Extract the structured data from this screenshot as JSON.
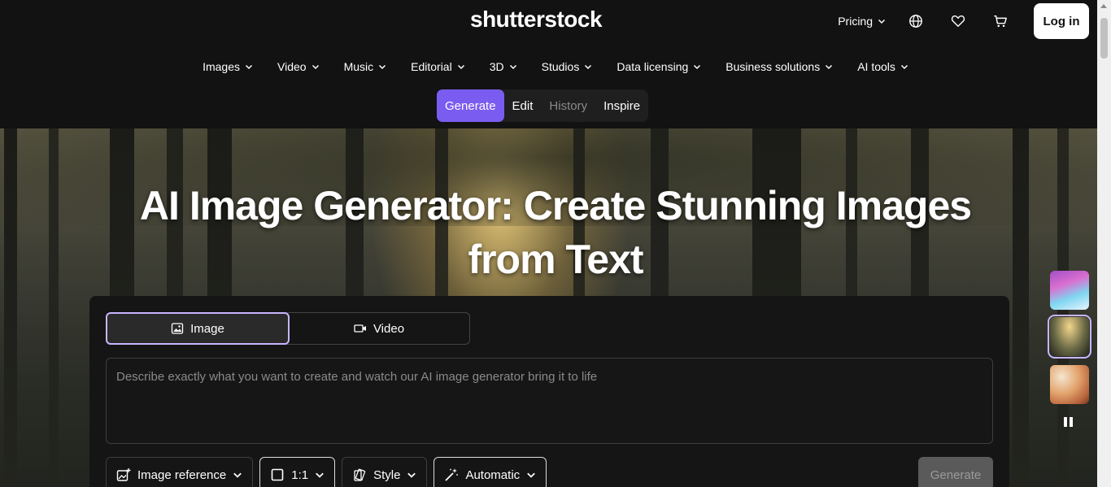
{
  "header": {
    "logo": "shutterstock",
    "pricing_label": "Pricing",
    "login_label": "Log in",
    "icons": [
      "globe-icon",
      "heart-icon",
      "cart-icon"
    ]
  },
  "nav": {
    "items": [
      {
        "label": "Images"
      },
      {
        "label": "Video"
      },
      {
        "label": "Music"
      },
      {
        "label": "Editorial"
      },
      {
        "label": "3D"
      },
      {
        "label": "Studios"
      },
      {
        "label": "Data licensing"
      },
      {
        "label": "Business solutions"
      },
      {
        "label": "AI tools"
      }
    ]
  },
  "subnav": {
    "items": [
      {
        "label": "Generate",
        "state": "active"
      },
      {
        "label": "Edit",
        "state": "normal"
      },
      {
        "label": "History",
        "state": "muted"
      },
      {
        "label": "Inspire",
        "state": "normal"
      }
    ]
  },
  "hero": {
    "title_line1": "AI Image Generator: Create Stunning Images",
    "title_line2": "from Text"
  },
  "generator": {
    "modes": [
      {
        "label": "Image",
        "selected": true,
        "icon": "image-icon"
      },
      {
        "label": "Video",
        "selected": false,
        "icon": "video-camera-icon"
      }
    ],
    "prompt_placeholder": "Describe exactly what you want to create and watch our AI image generator bring it to life",
    "prompt_value": "",
    "controls": {
      "image_reference": "Image reference",
      "aspect_ratio": "1:1",
      "style": "Style",
      "model": "Automatic"
    },
    "generate_label": "Generate",
    "generate_enabled": false
  },
  "carousel": {
    "thumbnails": [
      "pastel-landscape",
      "forest-sunlight",
      "bubbles-abstract"
    ],
    "selected_index": 1,
    "paused": false
  },
  "colors": {
    "accent": "#7b5cf0",
    "selected_border": "#c8b5ff",
    "background": "#121212"
  }
}
